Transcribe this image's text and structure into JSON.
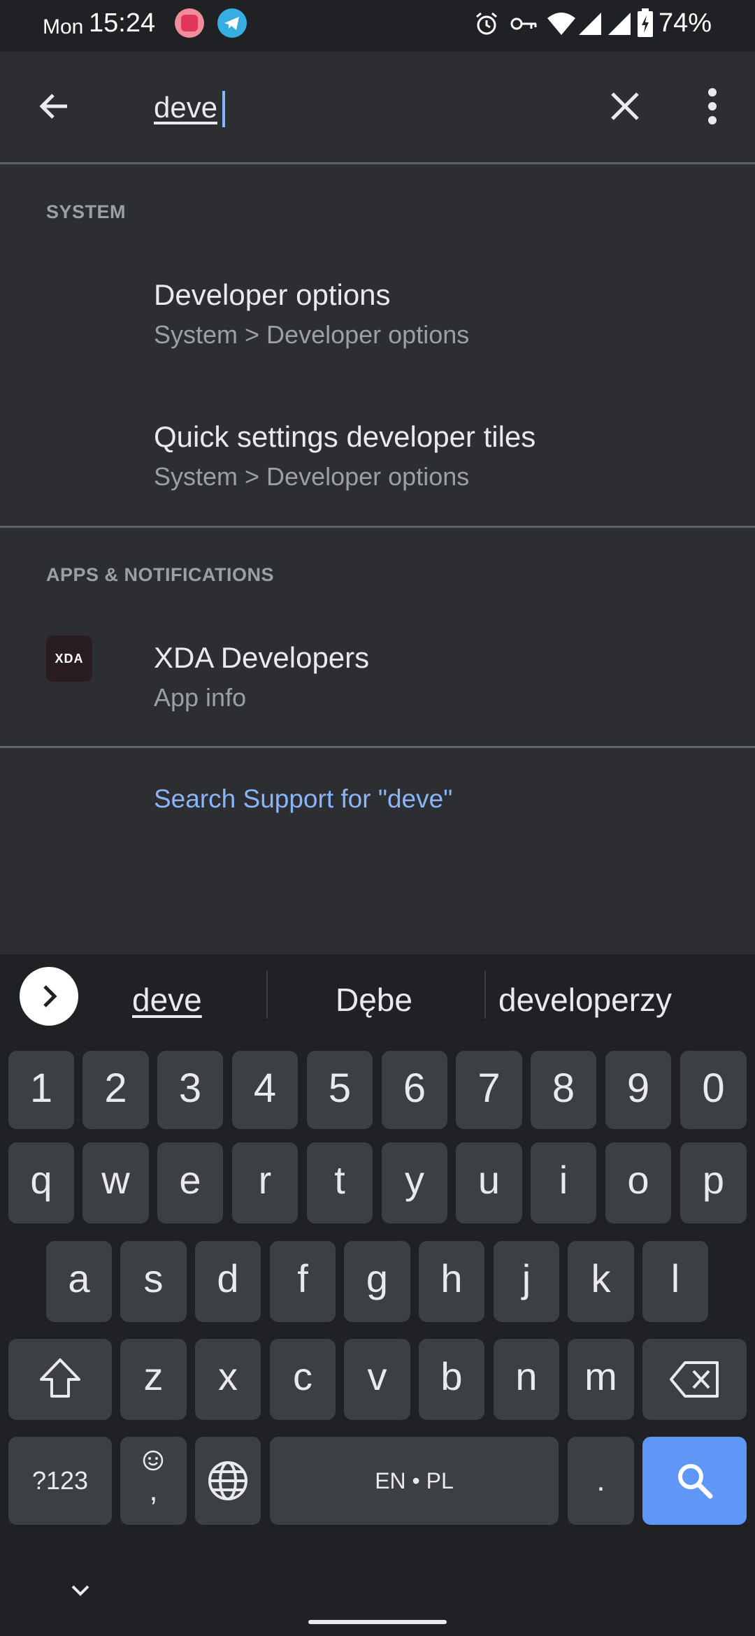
{
  "status_bar": {
    "day": "Mon",
    "time": "15:24",
    "battery": "74%",
    "icons": [
      "alarm-icon",
      "vpn-key-icon",
      "wifi-icon",
      "signal-icon",
      "signal-icon",
      "battery-charging-icon"
    ],
    "notification_apps": [
      "pocket-casts-icon",
      "telegram-icon"
    ]
  },
  "search": {
    "query": "deve",
    "back_icon": "arrow-back-icon",
    "clear_icon": "close-icon",
    "menu_icon": "more-vert-icon"
  },
  "sections": [
    {
      "header": "SYSTEM",
      "results": [
        {
          "title": "Developer options",
          "subtitle": "System > Developer options"
        },
        {
          "title": "Quick settings developer tiles",
          "subtitle": "System > Developer options"
        }
      ]
    },
    {
      "header": "APPS & NOTIFICATIONS",
      "results": [
        {
          "title": "XDA Developers",
          "subtitle": "App info",
          "icon_text": "XDA"
        }
      ]
    }
  ],
  "support_link": "Search Support for \"deve\"",
  "keyboard": {
    "suggestions": [
      "deve",
      "Dębe",
      "developerzy"
    ],
    "number_row": [
      "1",
      "2",
      "3",
      "4",
      "5",
      "6",
      "7",
      "8",
      "9",
      "0"
    ],
    "row1": [
      "q",
      "w",
      "e",
      "r",
      "t",
      "y",
      "u",
      "i",
      "o",
      "p"
    ],
    "row2": [
      "a",
      "s",
      "d",
      "f",
      "g",
      "h",
      "j",
      "k",
      "l"
    ],
    "row3": [
      "z",
      "x",
      "c",
      "v",
      "b",
      "n",
      "m"
    ],
    "symbols_label": "?123",
    "comma_label": ",",
    "space_label": "EN • PL",
    "period_label": ".",
    "colors": {
      "key": "#3c4043",
      "search_key": "#5e97f6",
      "background": "#202124"
    }
  },
  "colors": {
    "background": "#2d2e31",
    "accent": "#8ab4f8",
    "secondary_text": "#9aa0a6"
  }
}
